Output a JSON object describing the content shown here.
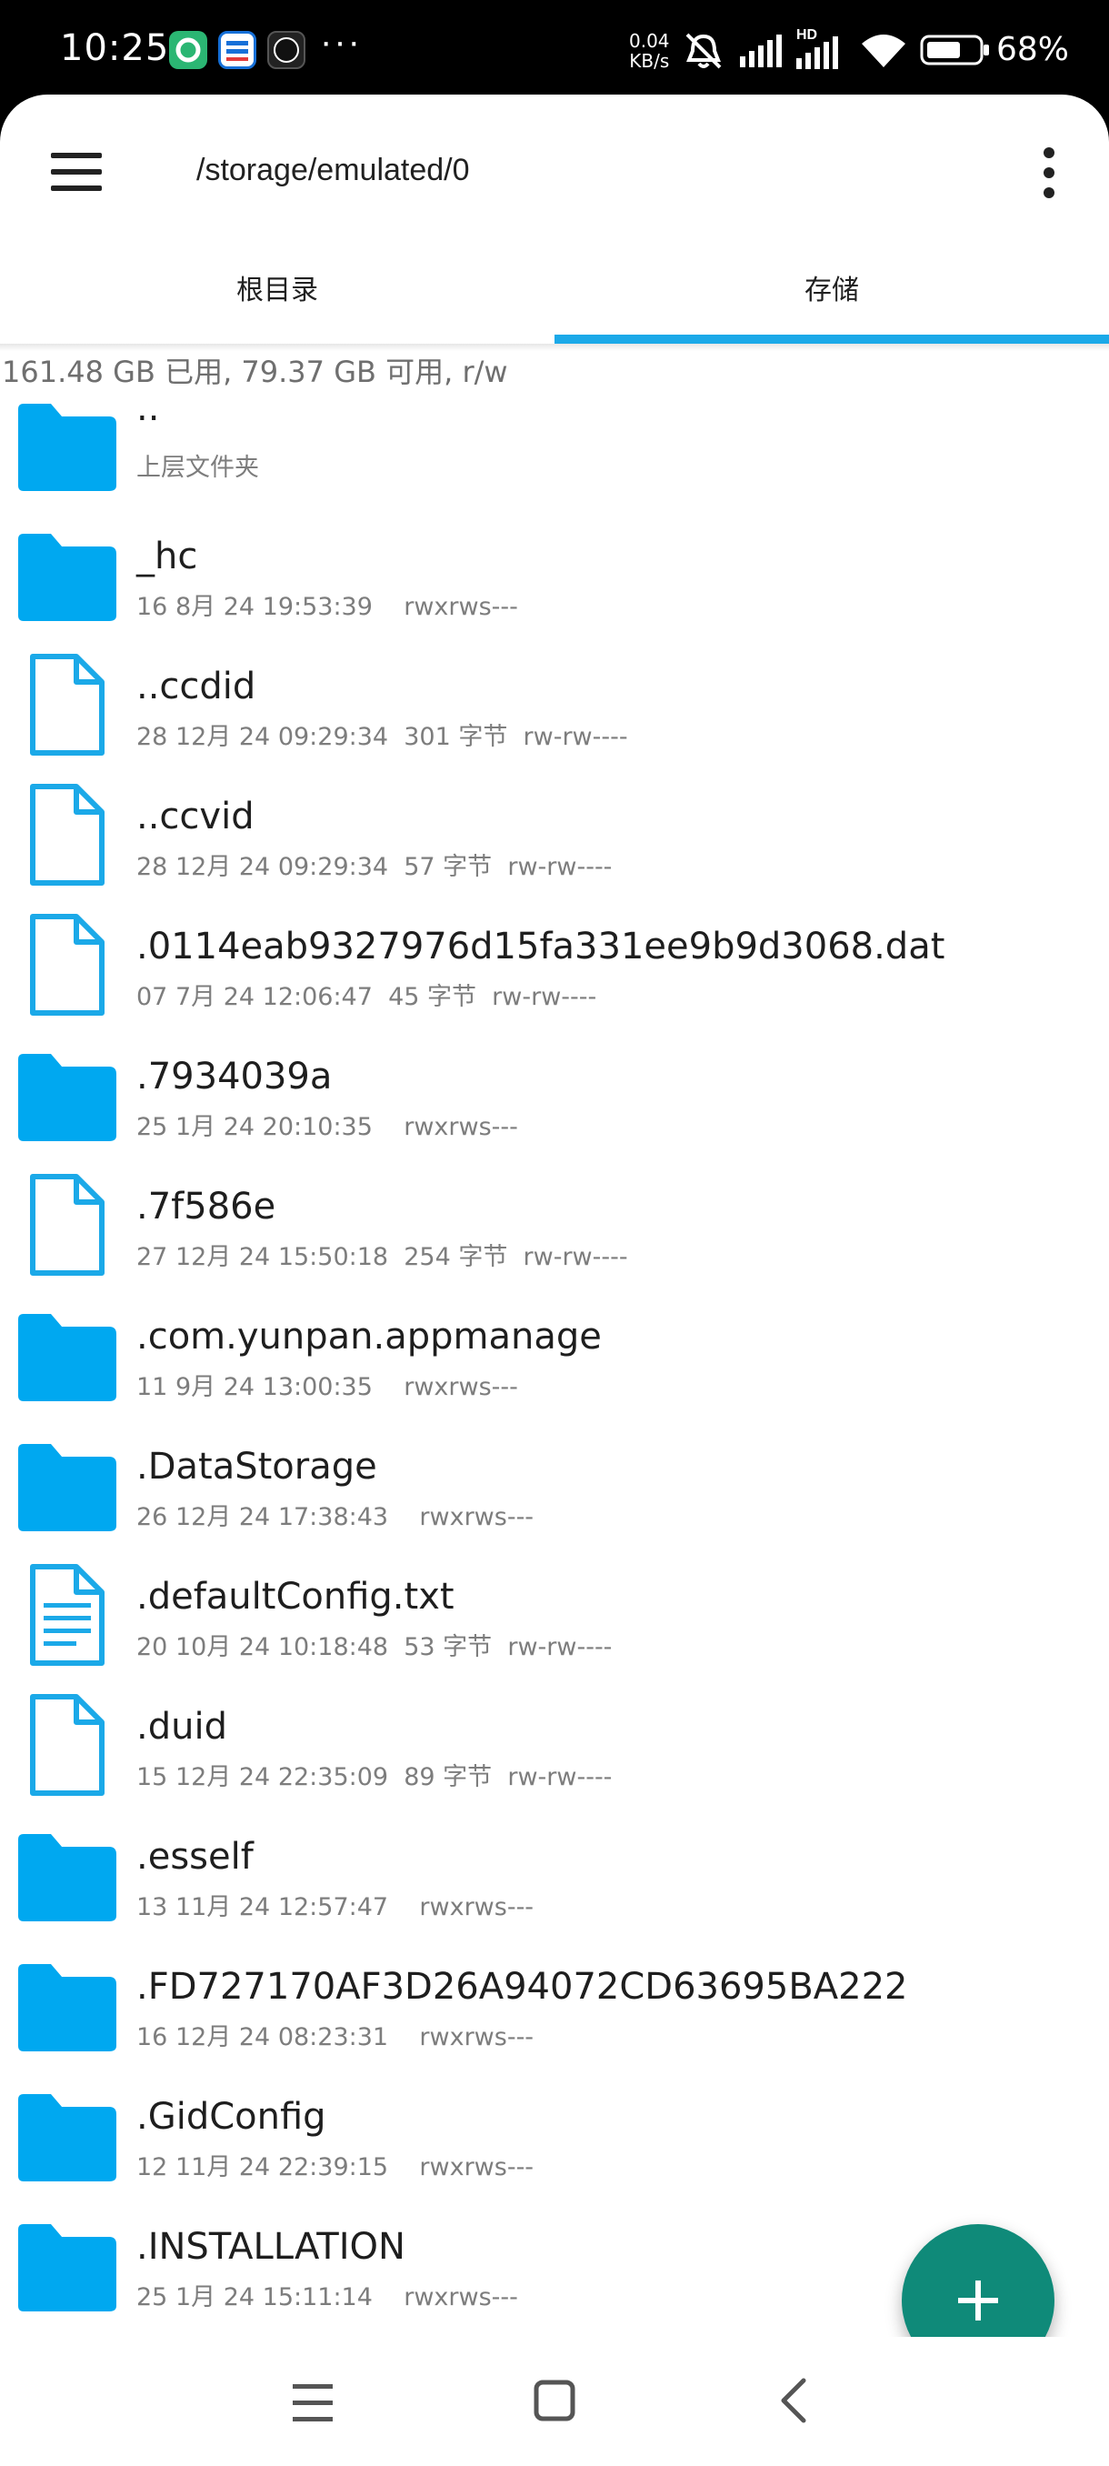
{
  "status_bar": {
    "time": "10:25",
    "more_indicator": "···",
    "net_speed_value": "0.04",
    "net_speed_unit": "KB/s",
    "hd_label": "HD",
    "battery_percent": "68%",
    "notification_apps": [
      "app-green-icon",
      "app-blue-icon",
      "soul-app-icon"
    ],
    "indicators": [
      "mute-icon",
      "signal-icon",
      "signal-hd-icon",
      "wifi-icon",
      "battery-icon"
    ]
  },
  "toolbar": {
    "path": "/storage/emulated/0",
    "menu_icon": "hamburger-menu-icon",
    "more_icon": "more-vert-icon"
  },
  "tabs": [
    {
      "label": "根目录",
      "selected": false
    },
    {
      "label": "存储",
      "selected": true
    }
  ],
  "storage_info": "161.48 GB 已用, 79.37 GB 可用, r/w",
  "colors": {
    "accent": "#1ba9e8",
    "folder": "#00a8f0",
    "fab": "#0f8a79",
    "text_primary": "#1e1e1e",
    "text_secondary": "#7d7d7d"
  },
  "files": [
    {
      "type": "folder",
      "name": "..",
      "meta": "上层文件夹"
    },
    {
      "type": "folder",
      "name": "_hc",
      "meta": "16 8月 24 19:53:39    rwxrws---"
    },
    {
      "type": "file",
      "name": "..ccdid",
      "meta": "28 12月 24 09:29:34  301 字节  rw-rw----"
    },
    {
      "type": "file",
      "name": "..ccvid",
      "meta": "28 12月 24 09:29:34  57 字节  rw-rw----"
    },
    {
      "type": "file",
      "name": ".0114eab9327976d15fa331ee9b9d3068.dat",
      "meta": "07 7月 24 12:06:47  45 字节  rw-rw----"
    },
    {
      "type": "folder",
      "name": ".7934039a",
      "meta": "25 1月 24 20:10:35    rwxrws---"
    },
    {
      "type": "file",
      "name": ".7f586e",
      "meta": "27 12月 24 15:50:18  254 字节  rw-rw----"
    },
    {
      "type": "folder",
      "name": ".com.yunpan.appmanage",
      "meta": "11 9月 24 13:00:35    rwxrws---"
    },
    {
      "type": "folder",
      "name": ".DataStorage",
      "meta": "26 12月 24 17:38:43    rwxrws---"
    },
    {
      "type": "text",
      "name": ".defaultConfig.txt",
      "meta": "20 10月 24 10:18:48  53 字节  rw-rw----"
    },
    {
      "type": "file",
      "name": ".duid",
      "meta": "15 12月 24 22:35:09  89 字节  rw-rw----"
    },
    {
      "type": "folder",
      "name": ".esself",
      "meta": "13 11月 24 12:57:47    rwxrws---"
    },
    {
      "type": "folder",
      "name": ".FD727170AF3D26A94072CD63695BA222",
      "meta": "16 12月 24 08:23:31    rwxrws---"
    },
    {
      "type": "folder",
      "name": ".GidConfig",
      "meta": "12 11月 24 22:39:15    rwxrws---"
    },
    {
      "type": "folder",
      "name": ".INSTALLATION",
      "meta": "25 1月 24 15:11:14    rwxrws---"
    }
  ],
  "fab": {
    "icon": "plus-icon"
  },
  "nav_bar": [
    {
      "icon": "menu-lines-icon"
    },
    {
      "icon": "home-square-icon"
    },
    {
      "icon": "back-chevron-icon"
    }
  ]
}
